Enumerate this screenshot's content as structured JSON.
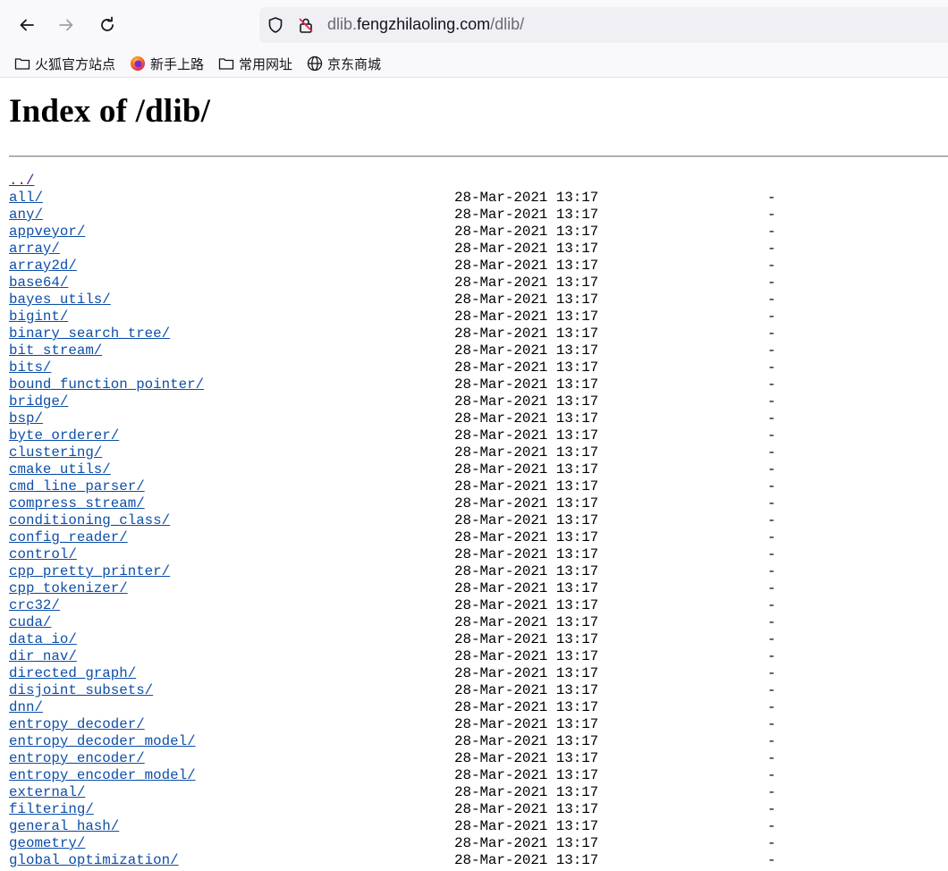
{
  "browser": {
    "url_host_prefix": "dlib.",
    "url_host_main": "fengzhilaoling.com",
    "url_path": "/dlib/",
    "bookmarks": [
      {
        "label": "火狐官方站点",
        "icon": "folder-icon"
      },
      {
        "label": "新手上路",
        "icon": "firefox-icon"
      },
      {
        "label": "常用网址",
        "icon": "folder-icon"
      },
      {
        "label": "京东商城",
        "icon": "globe-icon"
      }
    ]
  },
  "page": {
    "title": "Index of /dlib/",
    "parent_link": "../",
    "entries": [
      {
        "name": "all/",
        "date": "28-Mar-2021 13:17",
        "size": "-"
      },
      {
        "name": "any/",
        "date": "28-Mar-2021 13:17",
        "size": "-"
      },
      {
        "name": "appveyor/",
        "date": "28-Mar-2021 13:17",
        "size": "-"
      },
      {
        "name": "array/",
        "date": "28-Mar-2021 13:17",
        "size": "-"
      },
      {
        "name": "array2d/",
        "date": "28-Mar-2021 13:17",
        "size": "-"
      },
      {
        "name": "base64/",
        "date": "28-Mar-2021 13:17",
        "size": "-"
      },
      {
        "name": "bayes_utils/",
        "date": "28-Mar-2021 13:17",
        "size": "-"
      },
      {
        "name": "bigint/",
        "date": "28-Mar-2021 13:17",
        "size": "-"
      },
      {
        "name": "binary_search_tree/",
        "date": "28-Mar-2021 13:17",
        "size": "-"
      },
      {
        "name": "bit_stream/",
        "date": "28-Mar-2021 13:17",
        "size": "-"
      },
      {
        "name": "bits/",
        "date": "28-Mar-2021 13:17",
        "size": "-"
      },
      {
        "name": "bound_function_pointer/",
        "date": "28-Mar-2021 13:17",
        "size": "-"
      },
      {
        "name": "bridge/",
        "date": "28-Mar-2021 13:17",
        "size": "-"
      },
      {
        "name": "bsp/",
        "date": "28-Mar-2021 13:17",
        "size": "-"
      },
      {
        "name": "byte_orderer/",
        "date": "28-Mar-2021 13:17",
        "size": "-"
      },
      {
        "name": "clustering/",
        "date": "28-Mar-2021 13:17",
        "size": "-"
      },
      {
        "name": "cmake_utils/",
        "date": "28-Mar-2021 13:17",
        "size": "-"
      },
      {
        "name": "cmd_line_parser/",
        "date": "28-Mar-2021 13:17",
        "size": "-"
      },
      {
        "name": "compress_stream/",
        "date": "28-Mar-2021 13:17",
        "size": "-"
      },
      {
        "name": "conditioning_class/",
        "date": "28-Mar-2021 13:17",
        "size": "-"
      },
      {
        "name": "config_reader/",
        "date": "28-Mar-2021 13:17",
        "size": "-"
      },
      {
        "name": "control/",
        "date": "28-Mar-2021 13:17",
        "size": "-"
      },
      {
        "name": "cpp_pretty_printer/",
        "date": "28-Mar-2021 13:17",
        "size": "-"
      },
      {
        "name": "cpp_tokenizer/",
        "date": "28-Mar-2021 13:17",
        "size": "-"
      },
      {
        "name": "crc32/",
        "date": "28-Mar-2021 13:17",
        "size": "-"
      },
      {
        "name": "cuda/",
        "date": "28-Mar-2021 13:17",
        "size": "-"
      },
      {
        "name": "data_io/",
        "date": "28-Mar-2021 13:17",
        "size": "-"
      },
      {
        "name": "dir_nav/",
        "date": "28-Mar-2021 13:17",
        "size": "-"
      },
      {
        "name": "directed_graph/",
        "date": "28-Mar-2021 13:17",
        "size": "-"
      },
      {
        "name": "disjoint_subsets/",
        "date": "28-Mar-2021 13:17",
        "size": "-"
      },
      {
        "name": "dnn/",
        "date": "28-Mar-2021 13:17",
        "size": "-"
      },
      {
        "name": "entropy_decoder/",
        "date": "28-Mar-2021 13:17",
        "size": "-"
      },
      {
        "name": "entropy_decoder_model/",
        "date": "28-Mar-2021 13:17",
        "size": "-"
      },
      {
        "name": "entropy_encoder/",
        "date": "28-Mar-2021 13:17",
        "size": "-"
      },
      {
        "name": "entropy_encoder_model/",
        "date": "28-Mar-2021 13:17",
        "size": "-"
      },
      {
        "name": "external/",
        "date": "28-Mar-2021 13:17",
        "size": "-"
      },
      {
        "name": "filtering/",
        "date": "28-Mar-2021 13:17",
        "size": "-"
      },
      {
        "name": "general_hash/",
        "date": "28-Mar-2021 13:17",
        "size": "-"
      },
      {
        "name": "geometry/",
        "date": "28-Mar-2021 13:17",
        "size": "-"
      },
      {
        "name": "global_optimization/",
        "date": "28-Mar-2021 13:17",
        "size": "-"
      }
    ]
  }
}
